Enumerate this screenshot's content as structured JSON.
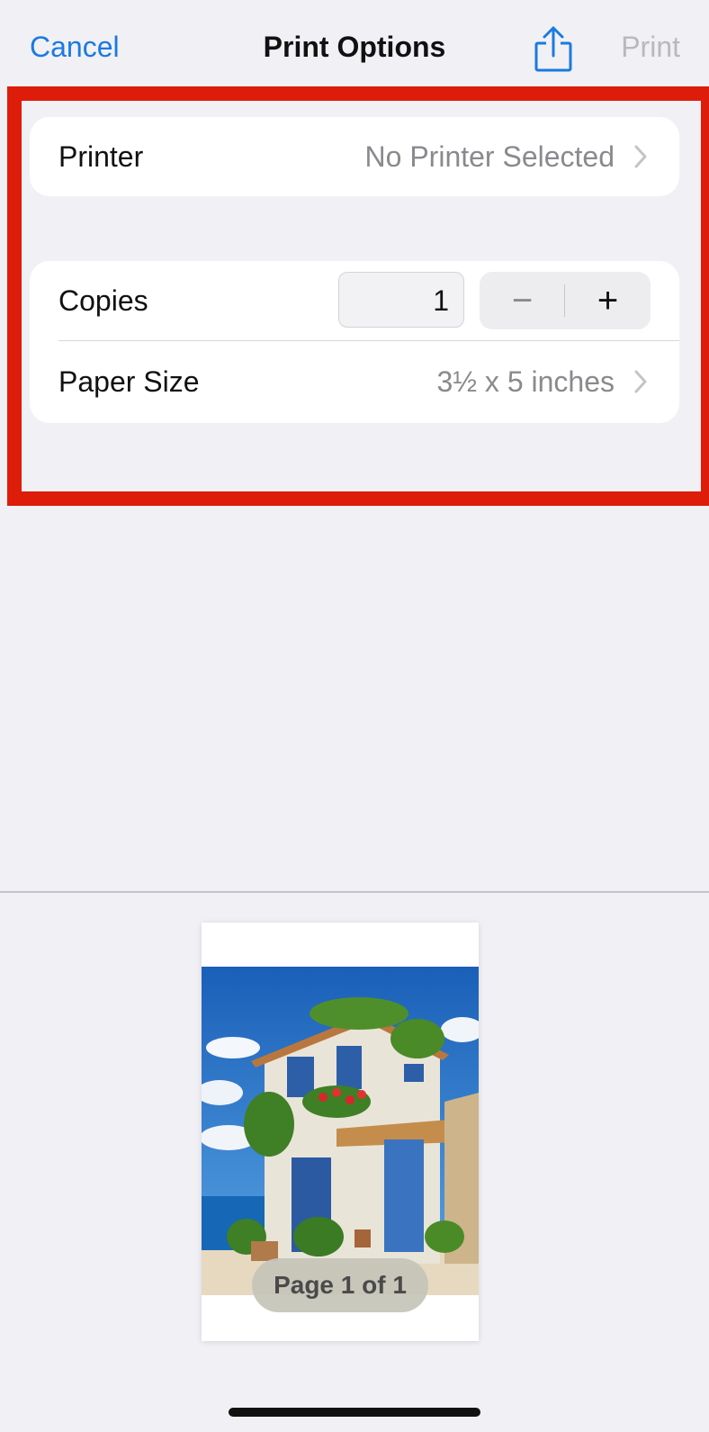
{
  "nav": {
    "cancel_label": "Cancel",
    "title": "Print Options",
    "share_icon": "share-icon",
    "print_label": "Print"
  },
  "printer_row": {
    "label": "Printer",
    "value": "No Printer Selected"
  },
  "copies_row": {
    "label": "Copies",
    "value": "1",
    "decrement": "−",
    "increment": "+"
  },
  "paper_row": {
    "label": "Paper Size",
    "value": "3½ x 5 inches"
  },
  "preview": {
    "badge": "Page 1 of 1"
  },
  "colors": {
    "accent": "#1a7ae0",
    "highlight": "#dd1c0a",
    "disabled": "#b8b8bd",
    "background": "#f1f0f5"
  }
}
